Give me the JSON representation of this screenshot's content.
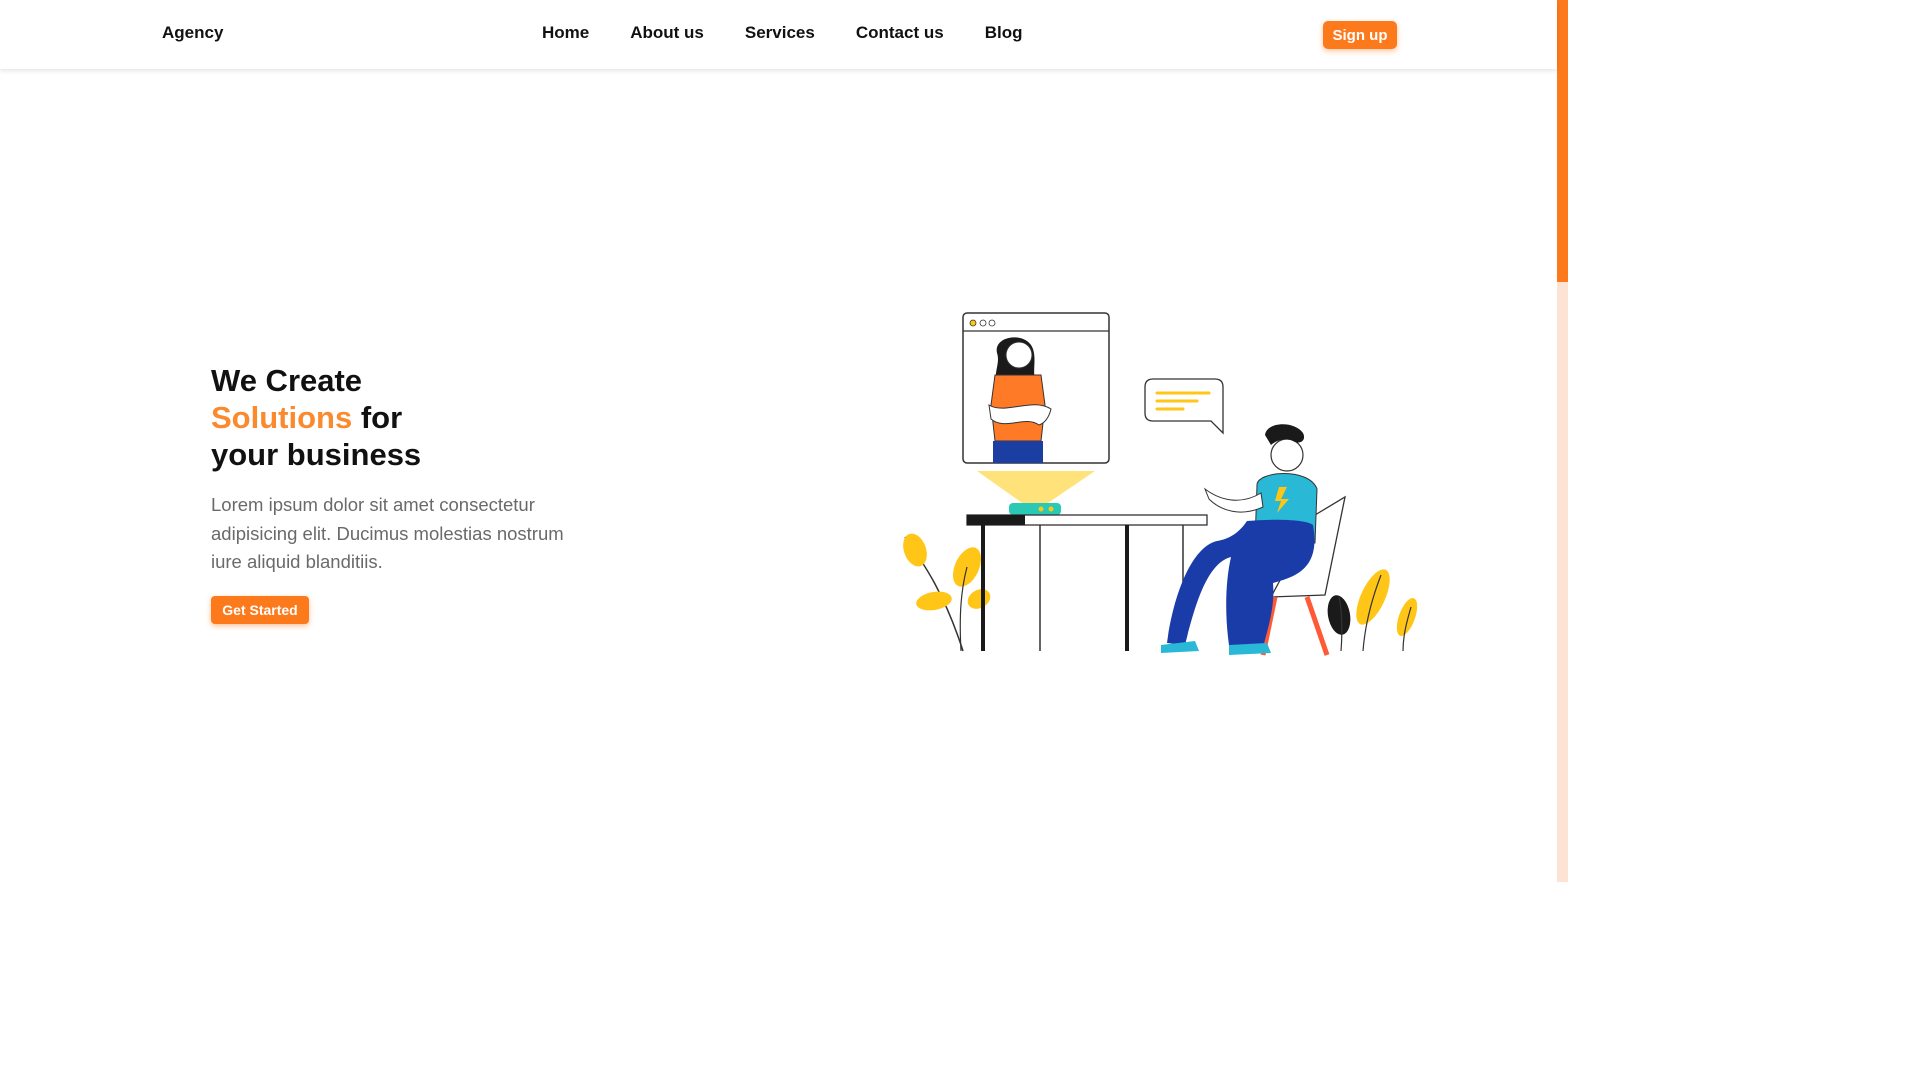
{
  "brand": "Agency",
  "nav": {
    "items": [
      {
        "label": "Home"
      },
      {
        "label": "About us"
      },
      {
        "label": "Services"
      },
      {
        "label": "Contact us"
      },
      {
        "label": "Blog"
      }
    ],
    "signup_label": "Sign up"
  },
  "hero": {
    "title_line1": "We Create",
    "title_accent": "Solutions",
    "title_line2_rest": " for",
    "title_line3": "your business",
    "description": "Lorem ipsum dolor sit amet consectetur adipisicing elit. Ducimus molestias nostrum iure aliquid blanditiis.",
    "cta_label": "Get Started"
  },
  "colors": {
    "accent": "#fd7a1c",
    "accent_text": "#fb8a2e",
    "text_dark": "#111111",
    "text_muted": "#6a6a6a",
    "scroll_track": "#fde3d3"
  },
  "illustration": {
    "name": "video-call-illustration"
  }
}
